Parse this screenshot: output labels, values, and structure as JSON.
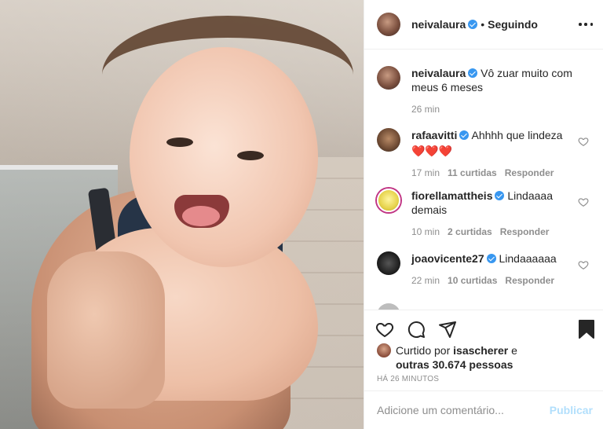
{
  "header": {
    "username": "neivalaura",
    "separator": "•",
    "follow_label": "Seguindo",
    "more_icon": "more-horizontal-icon"
  },
  "caption": {
    "username": "neivalaura",
    "text": "Vô zuar muito com meus 6 meses",
    "time": "26 min"
  },
  "comments": [
    {
      "username": "rafaavitti",
      "text": "Ahhhh que lindeza",
      "emoji": "❤️❤️❤️",
      "time": "17 min",
      "likes": "11 curtidas",
      "reply": "Responder"
    },
    {
      "username": "fiorellamattheis",
      "text": "Lindaaaa demais",
      "time": "10 min",
      "likes": "2 curtidas",
      "reply": "Responder"
    },
    {
      "username": "joaovicente27",
      "text": "Lindaaaaaa",
      "time": "22 min",
      "likes": "10 curtidas",
      "reply": "Responder"
    }
  ],
  "actions": {
    "like_icon": "heart-icon",
    "comment_icon": "comment-icon",
    "share_icon": "send-icon",
    "save_icon": "bookmark-icon"
  },
  "likes": {
    "prefix": "Curtido por",
    "user": "isascherer",
    "conj": "e",
    "others": "outras 30.674 pessoas"
  },
  "posted_time": "HÁ 26 MINUTOS",
  "add_comment": {
    "placeholder": "Adicione um comentário...",
    "publish_label": "Publicar"
  },
  "colors": {
    "verified": "#3897f0",
    "publish_disabled": "#b2dffc",
    "secondary_text": "#8e8e8e"
  }
}
